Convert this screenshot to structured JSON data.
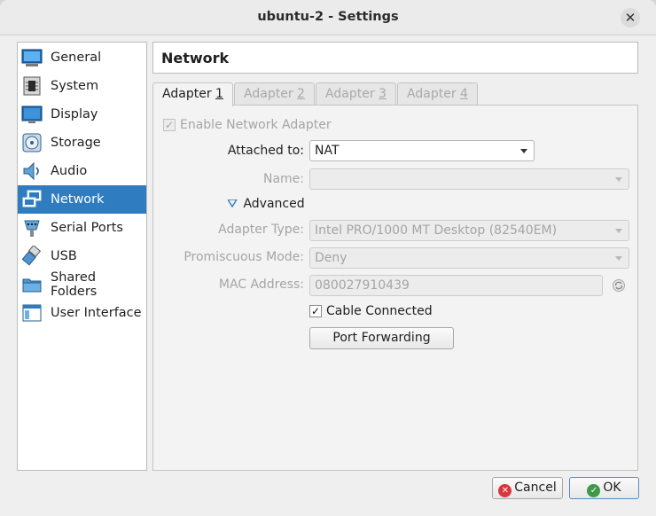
{
  "window": {
    "title": "ubuntu-2 - Settings",
    "close_glyph": "✕"
  },
  "sidebar": {
    "items": [
      {
        "label": "General",
        "icon": "general-icon"
      },
      {
        "label": "System",
        "icon": "system-icon"
      },
      {
        "label": "Display",
        "icon": "display-icon"
      },
      {
        "label": "Storage",
        "icon": "storage-icon"
      },
      {
        "label": "Audio",
        "icon": "audio-icon"
      },
      {
        "label": "Network",
        "icon": "network-icon",
        "selected": true
      },
      {
        "label": "Serial Ports",
        "icon": "serial-ports-icon"
      },
      {
        "label": "USB",
        "icon": "usb-icon"
      },
      {
        "label": "Shared Folders",
        "icon": "shared-folders-icon"
      },
      {
        "label": "User Interface",
        "icon": "user-interface-icon"
      }
    ]
  },
  "page": {
    "title": "Network"
  },
  "tabs": [
    {
      "label": "Adapter ",
      "num": "1",
      "active": true
    },
    {
      "label": "Adapter ",
      "num": "2",
      "active": false
    },
    {
      "label": "Adapter ",
      "num": "3",
      "active": false
    },
    {
      "label": "Adapter ",
      "num": "4",
      "active": false
    }
  ],
  "form": {
    "enable_adapter": {
      "label": "Enable Network Adapter",
      "checked": true,
      "enabled": false
    },
    "attached_to": {
      "label": "Attached to:",
      "value": "NAT"
    },
    "name": {
      "label": "Name:",
      "value": ""
    },
    "advanced": {
      "label": "Advanced",
      "expanded": true
    },
    "adapter_type": {
      "label": "Adapter Type:",
      "value": "Intel PRO/1000 MT Desktop (82540EM)"
    },
    "promiscuous_mode": {
      "label": "Promiscuous Mode:",
      "value": "Deny"
    },
    "mac_address": {
      "label": "MAC Address:",
      "value": "080027910439"
    },
    "cable_connected": {
      "label": "Cable Connected",
      "checked": true
    },
    "port_forwarding": {
      "label": "Port Forwarding"
    }
  },
  "buttons": {
    "cancel": "Cancel",
    "ok": "OK"
  },
  "colors": {
    "selection": "#2f7cc0",
    "cancel_icon": "#d9363e",
    "ok_icon": "#3f9a48"
  }
}
